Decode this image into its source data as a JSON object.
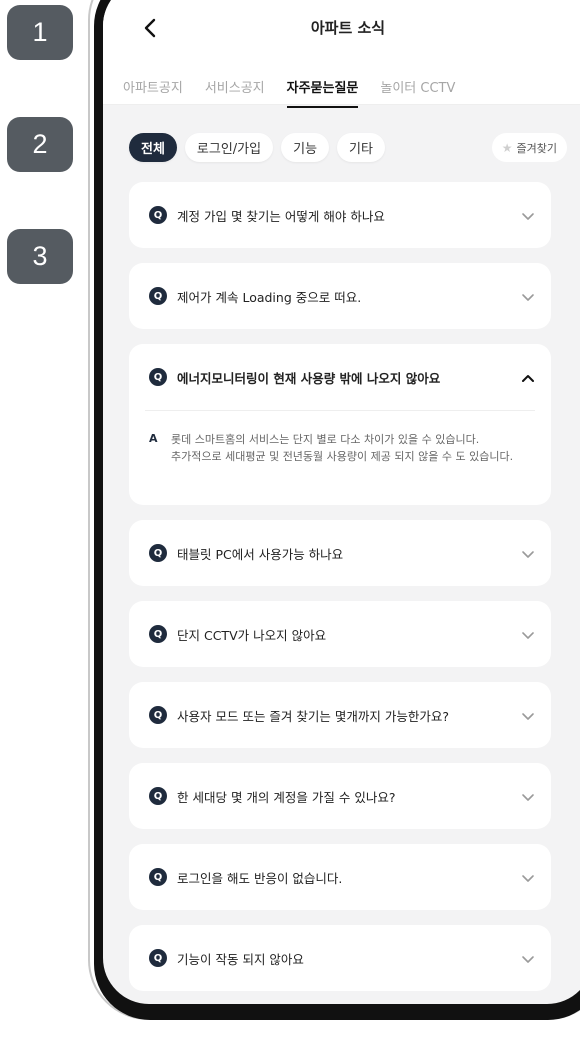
{
  "steps": [
    "1",
    "2",
    "3"
  ],
  "header": {
    "title": "아파트 소식"
  },
  "tabs": [
    {
      "label": "아파트공지",
      "active": false
    },
    {
      "label": "서비스공지",
      "active": false
    },
    {
      "label": "자주묻는질문",
      "active": true
    },
    {
      "label": "놀이터 CCTV",
      "active": false
    }
  ],
  "filters": [
    {
      "label": "전체",
      "active": true
    },
    {
      "label": "로그인/가입",
      "active": false
    },
    {
      "label": "기능",
      "active": false
    },
    {
      "label": "기타",
      "active": false
    }
  ],
  "favorites_label": "즐겨찾기",
  "q_marker": "Q",
  "a_marker": "A",
  "faqs": [
    {
      "question": "계정 가입 몇 찾기는 어떻게 해야 하나요",
      "expanded": false
    },
    {
      "question": "제어가 계속 Loading 중으로 떠요.",
      "expanded": false
    },
    {
      "question": "에너지모니터링이 현재 사용량 밖에 나오지 않아요",
      "expanded": true,
      "answer": "롯데 스마트홈의 서비스는 단지 별로 다소 차이가 있을 수 있습니다.\n추가적으로 세대평균 및 전년동월 사용량이 제공 되지 않을 수 도 있습니다."
    },
    {
      "question": "태블릿 PC에서 사용가능 하나요",
      "expanded": false
    },
    {
      "question": "단지 CCTV가 나오지 않아요",
      "expanded": false
    },
    {
      "question": "사용자 모드 또는 즐겨 찾기는 몇개까지 가능한가요?",
      "expanded": false
    },
    {
      "question": "한 세대당 몇 개의 계정을 가질 수 있나요?",
      "expanded": false
    },
    {
      "question": "로그인을 해도 반응이 없습니다.",
      "expanded": false
    },
    {
      "question": "기능이 작동 되지 않아요",
      "expanded": false
    }
  ]
}
